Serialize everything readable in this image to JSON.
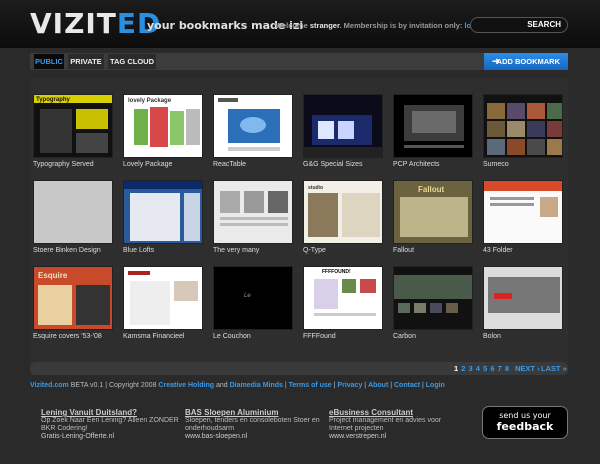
{
  "header": {
    "logo_part1": "VIZIT",
    "logo_part2": "ED",
    "tagline": "your bookmarks made izi",
    "welcome_prefix": "Welcome ",
    "username": "stranger",
    "welcome_mid": ". Membership is by invitation only: ",
    "login_link": "login.",
    "search_button": "SEARCH"
  },
  "tabs": [
    {
      "label": "PUBLIC",
      "active": true
    },
    {
      "label": "PRIVATE",
      "active": false
    },
    {
      "label": "TAG CLOUD",
      "active": false
    }
  ],
  "add_bookmark": "ADD BOOKMARK",
  "bookmarks": [
    {
      "title": "Typography Served"
    },
    {
      "title": "Lovely Package"
    },
    {
      "title": "ReacTable"
    },
    {
      "title": "G&G Special Sizes"
    },
    {
      "title": "PCP Architects"
    },
    {
      "title": "Sumeco"
    },
    {
      "title": "Stoere Binken Design"
    },
    {
      "title": "Blue Lofts"
    },
    {
      "title": "The very many"
    },
    {
      "title": "Q-Type"
    },
    {
      "title": "Fallout"
    },
    {
      "title": "43 Folder"
    },
    {
      "title": "Esquire covers '53-'08"
    },
    {
      "title": "Kamsma Financieel"
    },
    {
      "title": "Le Couchon"
    },
    {
      "title": "FFFFound"
    },
    {
      "title": "Carbon"
    },
    {
      "title": "Bolon"
    }
  ],
  "pager": {
    "pages": [
      "1",
      "2",
      "3",
      "4",
      "5",
      "6",
      "7",
      "8"
    ],
    "current": "1",
    "next": "NEXT ›",
    "last": "LAST »"
  },
  "footer": {
    "site": "Vizited.com",
    "beta": " BETA v0.1 | Copyright 2008 ",
    "creative": "Creative Holding",
    "and": " and ",
    "diamedia": "Diamedia Minds",
    "sep1": " | ",
    "terms": "Terms of use",
    "sep2": " | ",
    "privacy": "Privacy",
    "sep3": " | ",
    "about": "About",
    "sep4": " | ",
    "contact": "Contact",
    "sep5": " | ",
    "login": "Login"
  },
  "ads": [
    {
      "title": "Lening Vanuit Duitsland?",
      "line1": "Op Zoek Naar Een Lening? Alleen ZONDER",
      "line2": "BKR Codering!",
      "url": "Gratis-Lening-Offerte.nl"
    },
    {
      "title": "BAS Sloepen Aluminium",
      "line1": "Sloepen, tenders en consoleboten Stoer en",
      "line2": "onderhoudsarm",
      "url": "www.bas-sloepen.nl"
    },
    {
      "title": "eBusiness Consultant",
      "line1": "Project management en advies voor",
      "line2": "Internet projecten",
      "url": "www.verstrepen.nl"
    }
  ],
  "feedback": {
    "line1": "send us your",
    "line2": "feedback"
  },
  "colors": {
    "accent": "#2a8fe0",
    "background": "#2a2a2a"
  }
}
